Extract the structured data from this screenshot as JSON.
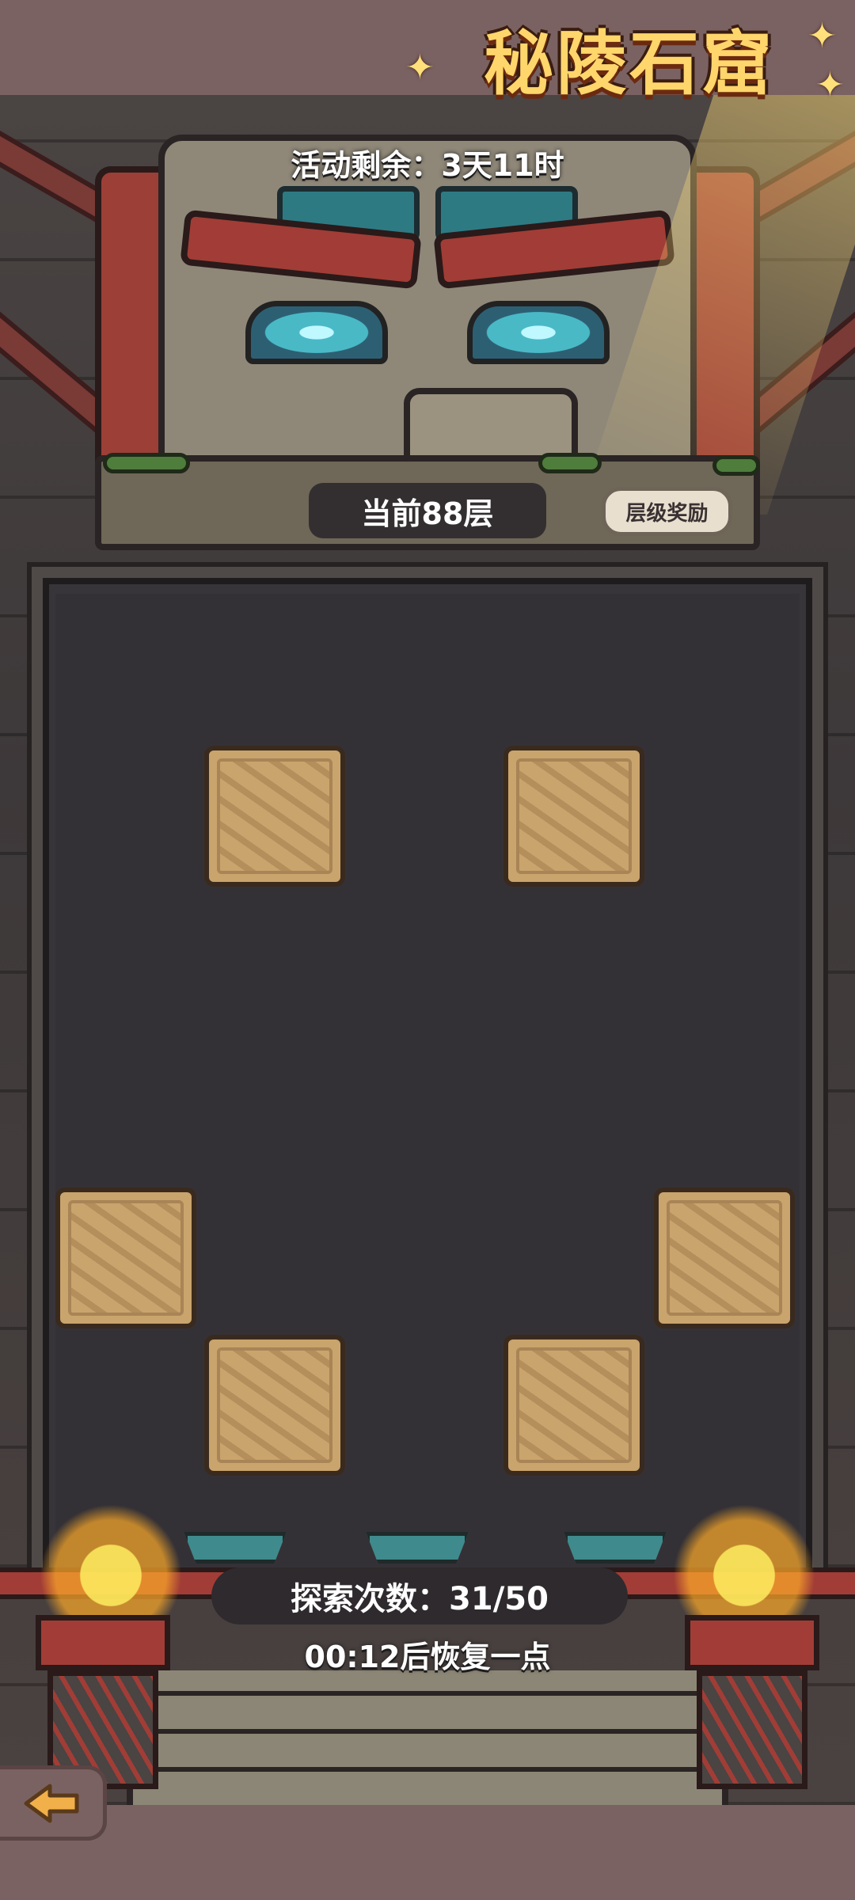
{
  "header": {
    "title": "秘陵石窟"
  },
  "event": {
    "time_remaining": "活动剩余：3天11时"
  },
  "floor": {
    "current": "当前88层",
    "reward_button": "层级奖励"
  },
  "board": {
    "tile_count": 6,
    "tile_state": "hidden"
  },
  "exploration": {
    "count_label": "探索次数：31/50",
    "used": 31,
    "max": 50,
    "recover_text": "00:12后恢复一点"
  },
  "navigation": {
    "back_icon": "back-arrow-icon"
  },
  "colors": {
    "title": "#ffd66b",
    "frame": "#7b6262",
    "tile": "#c9a46c",
    "accent_red": "#a13d36",
    "accent_teal": "#3f8a8c"
  }
}
